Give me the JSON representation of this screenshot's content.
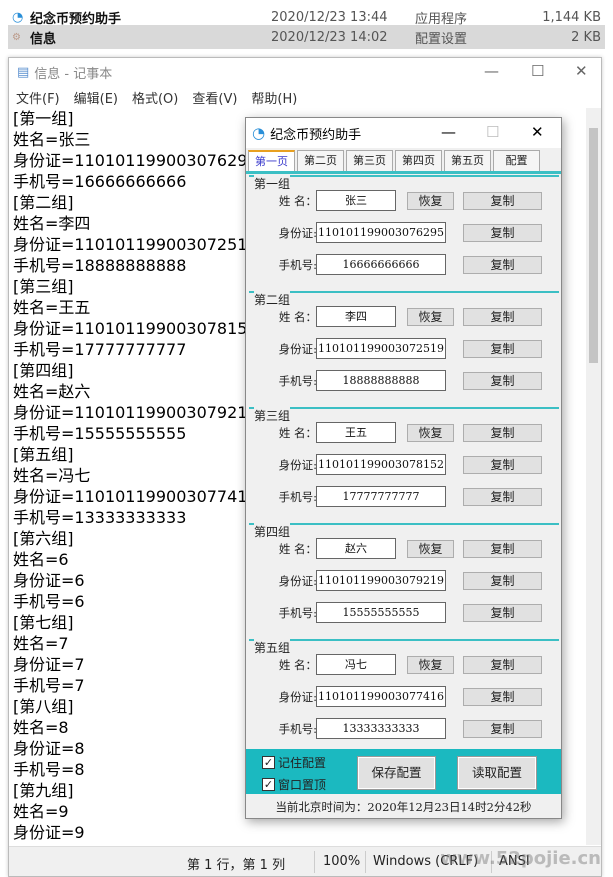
{
  "explorer": {
    "files": [
      {
        "name": "纪念币预约助手",
        "date": "2020/12/23 13:44",
        "type": "应用程序",
        "size": "1,144 KB"
      },
      {
        "name": "信息",
        "date": "2020/12/23 14:02",
        "type": "配置设置",
        "size": "2 KB"
      }
    ]
  },
  "notepad": {
    "title": "信息 - 记事本",
    "menu": [
      "文件(F)",
      "编辑(E)",
      "格式(O)",
      "查看(V)",
      "帮助(H)"
    ],
    "lines": [
      "[第一组]",
      "姓名=张三",
      "身份证=110101199003076295",
      "手机号=16666666666",
      "[第二组]",
      "姓名=李四",
      "身份证=110101199003072519",
      "手机号=18888888888",
      "[第三组]",
      "姓名=王五",
      "身份证=110101199003078152",
      "手机号=17777777777",
      "[第四组]",
      "姓名=赵六",
      "身份证=110101199003079219",
      "手机号=15555555555",
      "[第五组]",
      "姓名=冯七",
      "身份证=110101199003077416",
      "手机号=13333333333",
      "[第六组]",
      "姓名=6",
      "身份证=6",
      "手机号=6",
      "[第七组]",
      "姓名=7",
      "身份证=7",
      "手机号=7",
      "[第八组]",
      "姓名=8",
      "身份证=8",
      "手机号=8",
      "[第九组]",
      "姓名=9",
      "身份证=9"
    ],
    "status": {
      "position": "第 1 行，第 1 列",
      "zoom": "100%",
      "eol": "Windows (CRLF)",
      "encoding": "ANSI"
    }
  },
  "app": {
    "title": "纪念币预约助手",
    "tabs": [
      "第一页",
      "第二页",
      "第三页",
      "第四页",
      "第五页",
      "配置"
    ],
    "labels": {
      "name": "姓  名：",
      "id": "身份证:",
      "phone": "手机号:",
      "restore": "恢复",
      "copy": "复制"
    },
    "groups": [
      {
        "label": "第一组",
        "name": "张三",
        "id": "110101199003076295",
        "phone": "16666666666"
      },
      {
        "label": "第二组",
        "name": "李四",
        "id": "110101199003072519",
        "phone": "18888888888"
      },
      {
        "label": "第三组",
        "name": "王五",
        "id": "110101199003078152",
        "phone": "17777777777"
      },
      {
        "label": "第四组",
        "name": "赵六",
        "id": "110101199003079219",
        "phone": "15555555555"
      },
      {
        "label": "第五组",
        "name": "冯七",
        "id": "110101199003077416",
        "phone": "13333333333"
      }
    ],
    "remember_config": "记住配置",
    "window_on_top": "窗口置顶",
    "save_config": "保存配置",
    "load_config": "读取配置",
    "time_text": "当前北京时间为：2020年12月23日14时2分42秒",
    "accent": "#1bb9c0"
  }
}
